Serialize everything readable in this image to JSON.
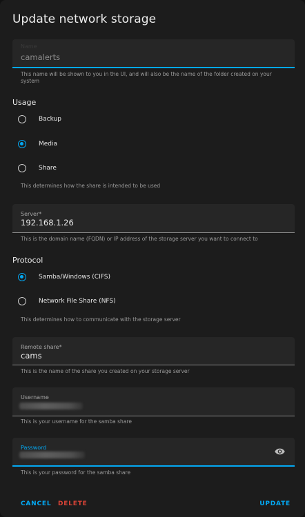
{
  "dialog": {
    "title": "Update network storage"
  },
  "name_field": {
    "label": "Name",
    "value": "camalerts",
    "helper": "This name will be shown to you in the UI, and will also be the name of the folder created on your system"
  },
  "usage": {
    "label": "Usage",
    "options": [
      {
        "label": "Backup",
        "checked": false
      },
      {
        "label": "Media",
        "checked": true
      },
      {
        "label": "Share",
        "checked": false
      }
    ],
    "helper": "This determines how the share is intended to be used"
  },
  "server_field": {
    "label": "Server*",
    "value": "192.168.1.26",
    "helper": "This is the domain name (FQDN) or IP address of the storage server you want to connect to"
  },
  "protocol": {
    "label": "Protocol",
    "options": [
      {
        "label": "Samba/Windows (CIFS)",
        "checked": true
      },
      {
        "label": "Network File Share (NFS)",
        "checked": false
      }
    ],
    "helper": "This determines how to communicate with the storage server"
  },
  "remote_share_field": {
    "label": "Remote share*",
    "value": "cams",
    "helper": "This is the name of the share you created on your storage server"
  },
  "username_field": {
    "label": "Username",
    "helper": "This is your username for the samba share"
  },
  "password_field": {
    "label": "Password",
    "helper": "This is your password for the samba share",
    "toggle_icon": "eye-icon"
  },
  "actions": {
    "cancel": "CANCEL",
    "delete": "DELETE",
    "update": "UPDATE"
  },
  "colors": {
    "accent": "#03a9f4",
    "danger": "#db4437",
    "background": "#1c1c1c",
    "field": "#262626"
  }
}
